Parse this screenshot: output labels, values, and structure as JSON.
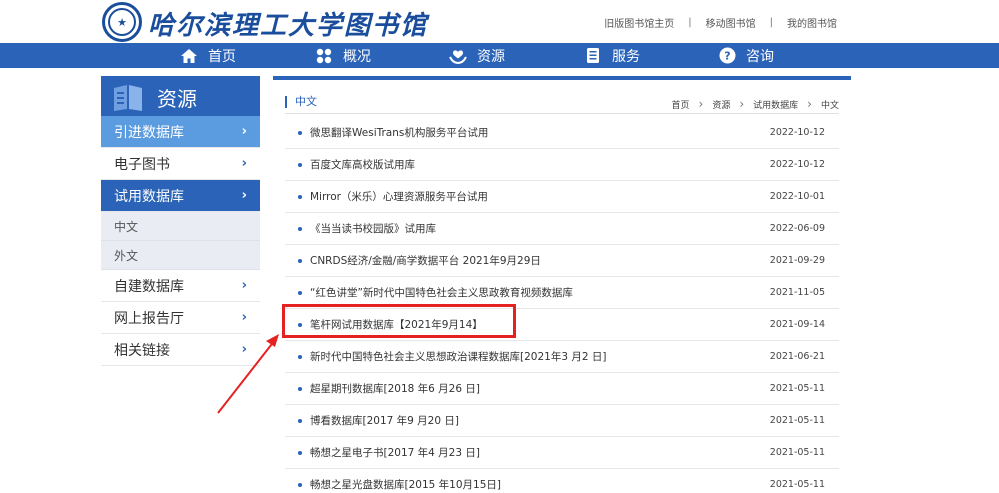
{
  "header": {
    "logo_text": "哈尔滨理工大学图书馆",
    "links": [
      "旧版图书馆主页",
      "移动图书馆",
      "我的图书馆"
    ]
  },
  "nav": [
    {
      "label": "首页",
      "icon": "home-icon"
    },
    {
      "label": "概况",
      "icon": "grid-icon"
    },
    {
      "label": "资源",
      "icon": "hands-heart-icon"
    },
    {
      "label": "服务",
      "icon": "document-icon"
    },
    {
      "label": "咨询",
      "icon": "question-icon"
    }
  ],
  "sidebar": {
    "title": "资源",
    "items": [
      {
        "label": "引进数据库",
        "chev": "›"
      },
      {
        "label": "电子图书",
        "chev": "›"
      },
      {
        "label": "试用数据库",
        "chev": "›"
      },
      {
        "label": "中文"
      },
      {
        "label": "外文"
      },
      {
        "label": "自建数据库",
        "chev": "›"
      },
      {
        "label": "网上报告厅",
        "chev": "›"
      },
      {
        "label": "相关链接",
        "chev": "›"
      }
    ]
  },
  "main": {
    "category": "中文",
    "breadcrumb": [
      "首页",
      "资源",
      "试用数据库",
      "中文"
    ],
    "rows": [
      {
        "title": "微思翻译WesiTrans机构服务平台试用",
        "date": "2022-10-12"
      },
      {
        "title": "百度文库高校版试用库",
        "date": "2022-10-12"
      },
      {
        "title": "Mirror（米乐）心理资源服务平台试用",
        "date": "2022-10-01"
      },
      {
        "title": "《当当读书校园版》试用库",
        "date": "2022-06-09"
      },
      {
        "title": "CNRDS经济/金融/商学数据平台 2021年9月29日",
        "date": "2021-09-29"
      },
      {
        "title": "“红色讲堂”新时代中国特色社会主义思政教育视频数据库",
        "date": "2021-11-05"
      },
      {
        "title": "笔杆网试用数据库【2021年9月14】",
        "date": "2021-09-14"
      },
      {
        "title": "新时代中国特色社会主义思想政治课程数据库[2021年3 月2 日]",
        "date": "2021-06-21"
      },
      {
        "title": "超星期刊数据库[2018 年6 月26 日]",
        "date": "2021-05-11"
      },
      {
        "title": "博看数据库[2017 年9 月20 日]",
        "date": "2021-05-11"
      },
      {
        "title": "畅想之星电子书[2017 年4 月23 日]",
        "date": "2021-05-11"
      },
      {
        "title": "畅想之星光盘数据库[2015 年10月15日]",
        "date": "2021-05-11"
      }
    ]
  },
  "colors": {
    "brand": "#2a63b8",
    "highlight": "#e52222"
  }
}
